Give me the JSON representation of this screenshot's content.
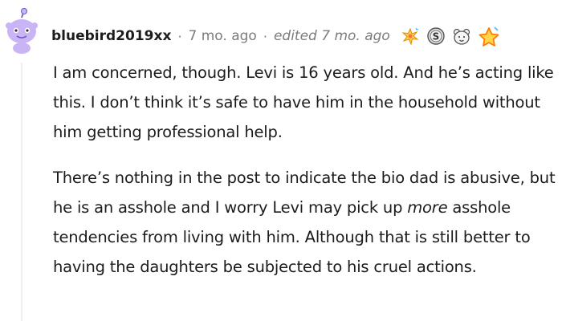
{
  "comment": {
    "username": "bluebird2019xx",
    "separator": "·",
    "timestamp": "7 mo. ago",
    "edited": "edited 7 mo. ago",
    "awards": [
      "starburst-award-icon",
      "silver-s-award-icon",
      "wholesome-bear-award-icon",
      "gold-star-award-icon"
    ],
    "paragraph1": "I am concerned, though. Levi is 16 years old. And he’s acting like this. I don’t think it’s safe to have him in the household without him getting professional help.",
    "paragraph2_before": "There’s nothing in the post to indicate the bio dad is abusive, but he is an asshole and I worry Levi may pick up ",
    "paragraph2_emphasis": "more",
    "paragraph2_after": " asshole tendencies from living with him. Although that is still better to having the daughters be subjected to his cruel actions."
  },
  "colors": {
    "avatar": "#c9b5f5",
    "meta_text": "#7c7c7c",
    "thread_line": "#edeff1",
    "gold": "#ffb000"
  }
}
